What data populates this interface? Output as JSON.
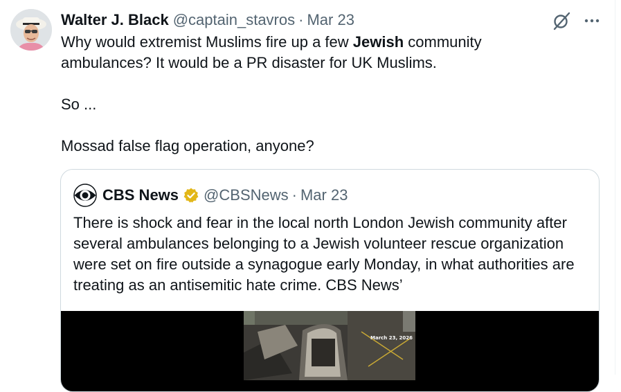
{
  "tweet": {
    "author_name": "Walter J. Black",
    "handle": "@captain_stavros",
    "separator": "·",
    "date": "Mar 23",
    "text": {
      "line1_before": "Why would extremist Muslims fire up a few ",
      "line1_bold": "Jewish",
      "line1_after": " community",
      "line2": "ambulances? It would be a PR disaster for UK Muslims.",
      "line3": "So ...",
      "line4": "Mossad false flag operation, anyone?"
    },
    "actions": {
      "grok_icon": "grok-slash-circle-icon",
      "more_icon": "more-horizontal-icon"
    }
  },
  "quote": {
    "author_name": "CBS News",
    "handle": "@CBSNews",
    "separator": "·",
    "date": "Mar 23",
    "verified_icon": "verified-gold-badge-icon",
    "text": "There is shock and fear in the local north London Jewish community after several ambulances belonging to a Jewish volunteer rescue organization were set on fire outside a synagogue early Monday, in what authorities are treating as an antisemitic hate crime. CBS News’",
    "media": {
      "date_stamp": "March 23, 2026"
    }
  },
  "colors": {
    "text_primary": "#0f1419",
    "text_secondary": "#536471",
    "border": "#cfd9de",
    "verified_gold": "#e2b719"
  }
}
